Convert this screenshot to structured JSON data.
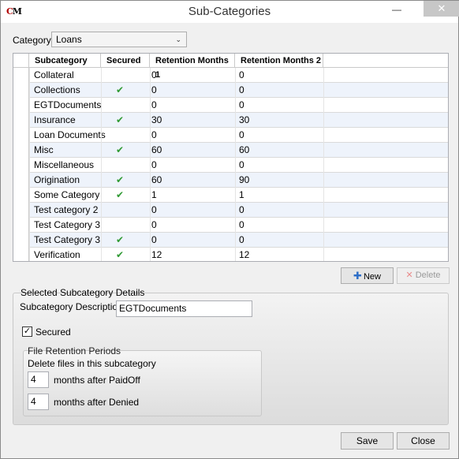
{
  "window": {
    "title": "Sub-Categories",
    "logo_text": "CM",
    "minimize_glyph": "—",
    "close_glyph": "✕"
  },
  "category": {
    "label": "Category",
    "selected": "Loans"
  },
  "grid": {
    "columns": [
      "Subcategory",
      "Secured",
      "Retention Months 1",
      "Retention Months 2"
    ],
    "rows": [
      {
        "name": "Collateral",
        "secured": false,
        "m1": "0",
        "m2": "0"
      },
      {
        "name": "Collections",
        "secured": true,
        "m1": "0",
        "m2": "0"
      },
      {
        "name": "EGTDocuments",
        "secured": false,
        "m1": "0",
        "m2": "0"
      },
      {
        "name": "Insurance",
        "secured": true,
        "m1": "30",
        "m2": "30"
      },
      {
        "name": "Loan Documents",
        "secured": false,
        "m1": "0",
        "m2": "0"
      },
      {
        "name": "Misc",
        "secured": true,
        "m1": "60",
        "m2": "60"
      },
      {
        "name": "Miscellaneous",
        "secured": false,
        "m1": "0",
        "m2": "0"
      },
      {
        "name": "Origination",
        "secured": true,
        "m1": "60",
        "m2": "90"
      },
      {
        "name": "Some Category",
        "secured": true,
        "m1": "1",
        "m2": "1"
      },
      {
        "name": "Test category 2",
        "secured": false,
        "m1": "0",
        "m2": "0"
      },
      {
        "name": "Test Category 3",
        "secured": false,
        "m1": "0",
        "m2": "0"
      },
      {
        "name": "Test Category 3",
        "secured": true,
        "m1": "0",
        "m2": "0"
      },
      {
        "name": "Verification",
        "secured": true,
        "m1": "12",
        "m2": "12"
      }
    ],
    "check_color": "#2f9a33"
  },
  "actions": {
    "new_label": "New",
    "delete_label": "Delete"
  },
  "details": {
    "group_label": "Selected Subcategory Details",
    "description_label": "Subcategory Description",
    "description_value": "EGTDocuments",
    "secured_label": "Secured",
    "secured_checked": true,
    "retention": {
      "group_label": "File Retention Periods",
      "sublabel": "Delete files in this subcategory",
      "paidoff_value": "4",
      "paidoff_label": "months after PaidOff",
      "denied_value": "4",
      "denied_label": "months after Denied"
    }
  },
  "footer": {
    "save_label": "Save",
    "close_label": "Close"
  }
}
